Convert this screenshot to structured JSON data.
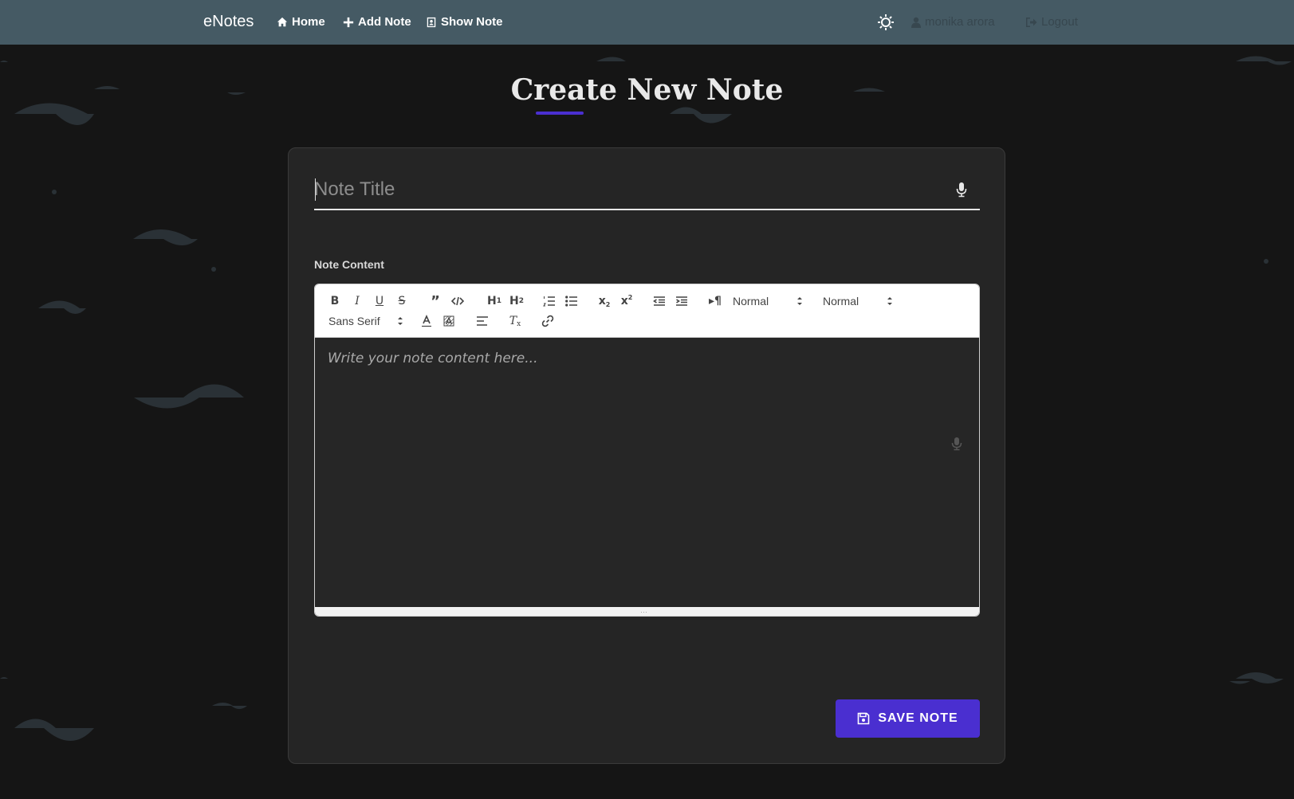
{
  "navbar": {
    "brand": "eNotes",
    "links": [
      {
        "label": "Home",
        "icon": "home-icon"
      },
      {
        "label": "Add Note",
        "icon": "plus-icon"
      },
      {
        "label": "Show Note",
        "icon": "address-book-icon"
      }
    ],
    "theme_toggle_icon": "sun-icon",
    "user": {
      "label": "monika arora",
      "icon": "user-icon"
    },
    "logout": {
      "label": "Logout",
      "icon": "sign-out-icon"
    }
  },
  "page": {
    "title": "Create New Note",
    "accent_color": "#4a2fd0"
  },
  "form": {
    "title_placeholder": "Note Title",
    "title_value": "",
    "content_label": "Note Content",
    "content_placeholder": "Write your note content here...",
    "save_label": "SAVE NOTE"
  },
  "toolbar": {
    "buttons": [
      "bold",
      "italic",
      "underline",
      "strike",
      "blockquote",
      "code-block",
      "header-1",
      "header-2",
      "ordered-list",
      "bullet-list",
      "subscript",
      "superscript",
      "outdent",
      "indent",
      "text-direction",
      "text-color",
      "background-color",
      "align",
      "clean",
      "link"
    ],
    "size_select": "Normal",
    "header_select": "Normal",
    "font_select": "Sans Serif"
  },
  "colors": {
    "navbar": "#455a64",
    "background": "#151515",
    "card": "#252525",
    "button": "#4a2fd0"
  }
}
